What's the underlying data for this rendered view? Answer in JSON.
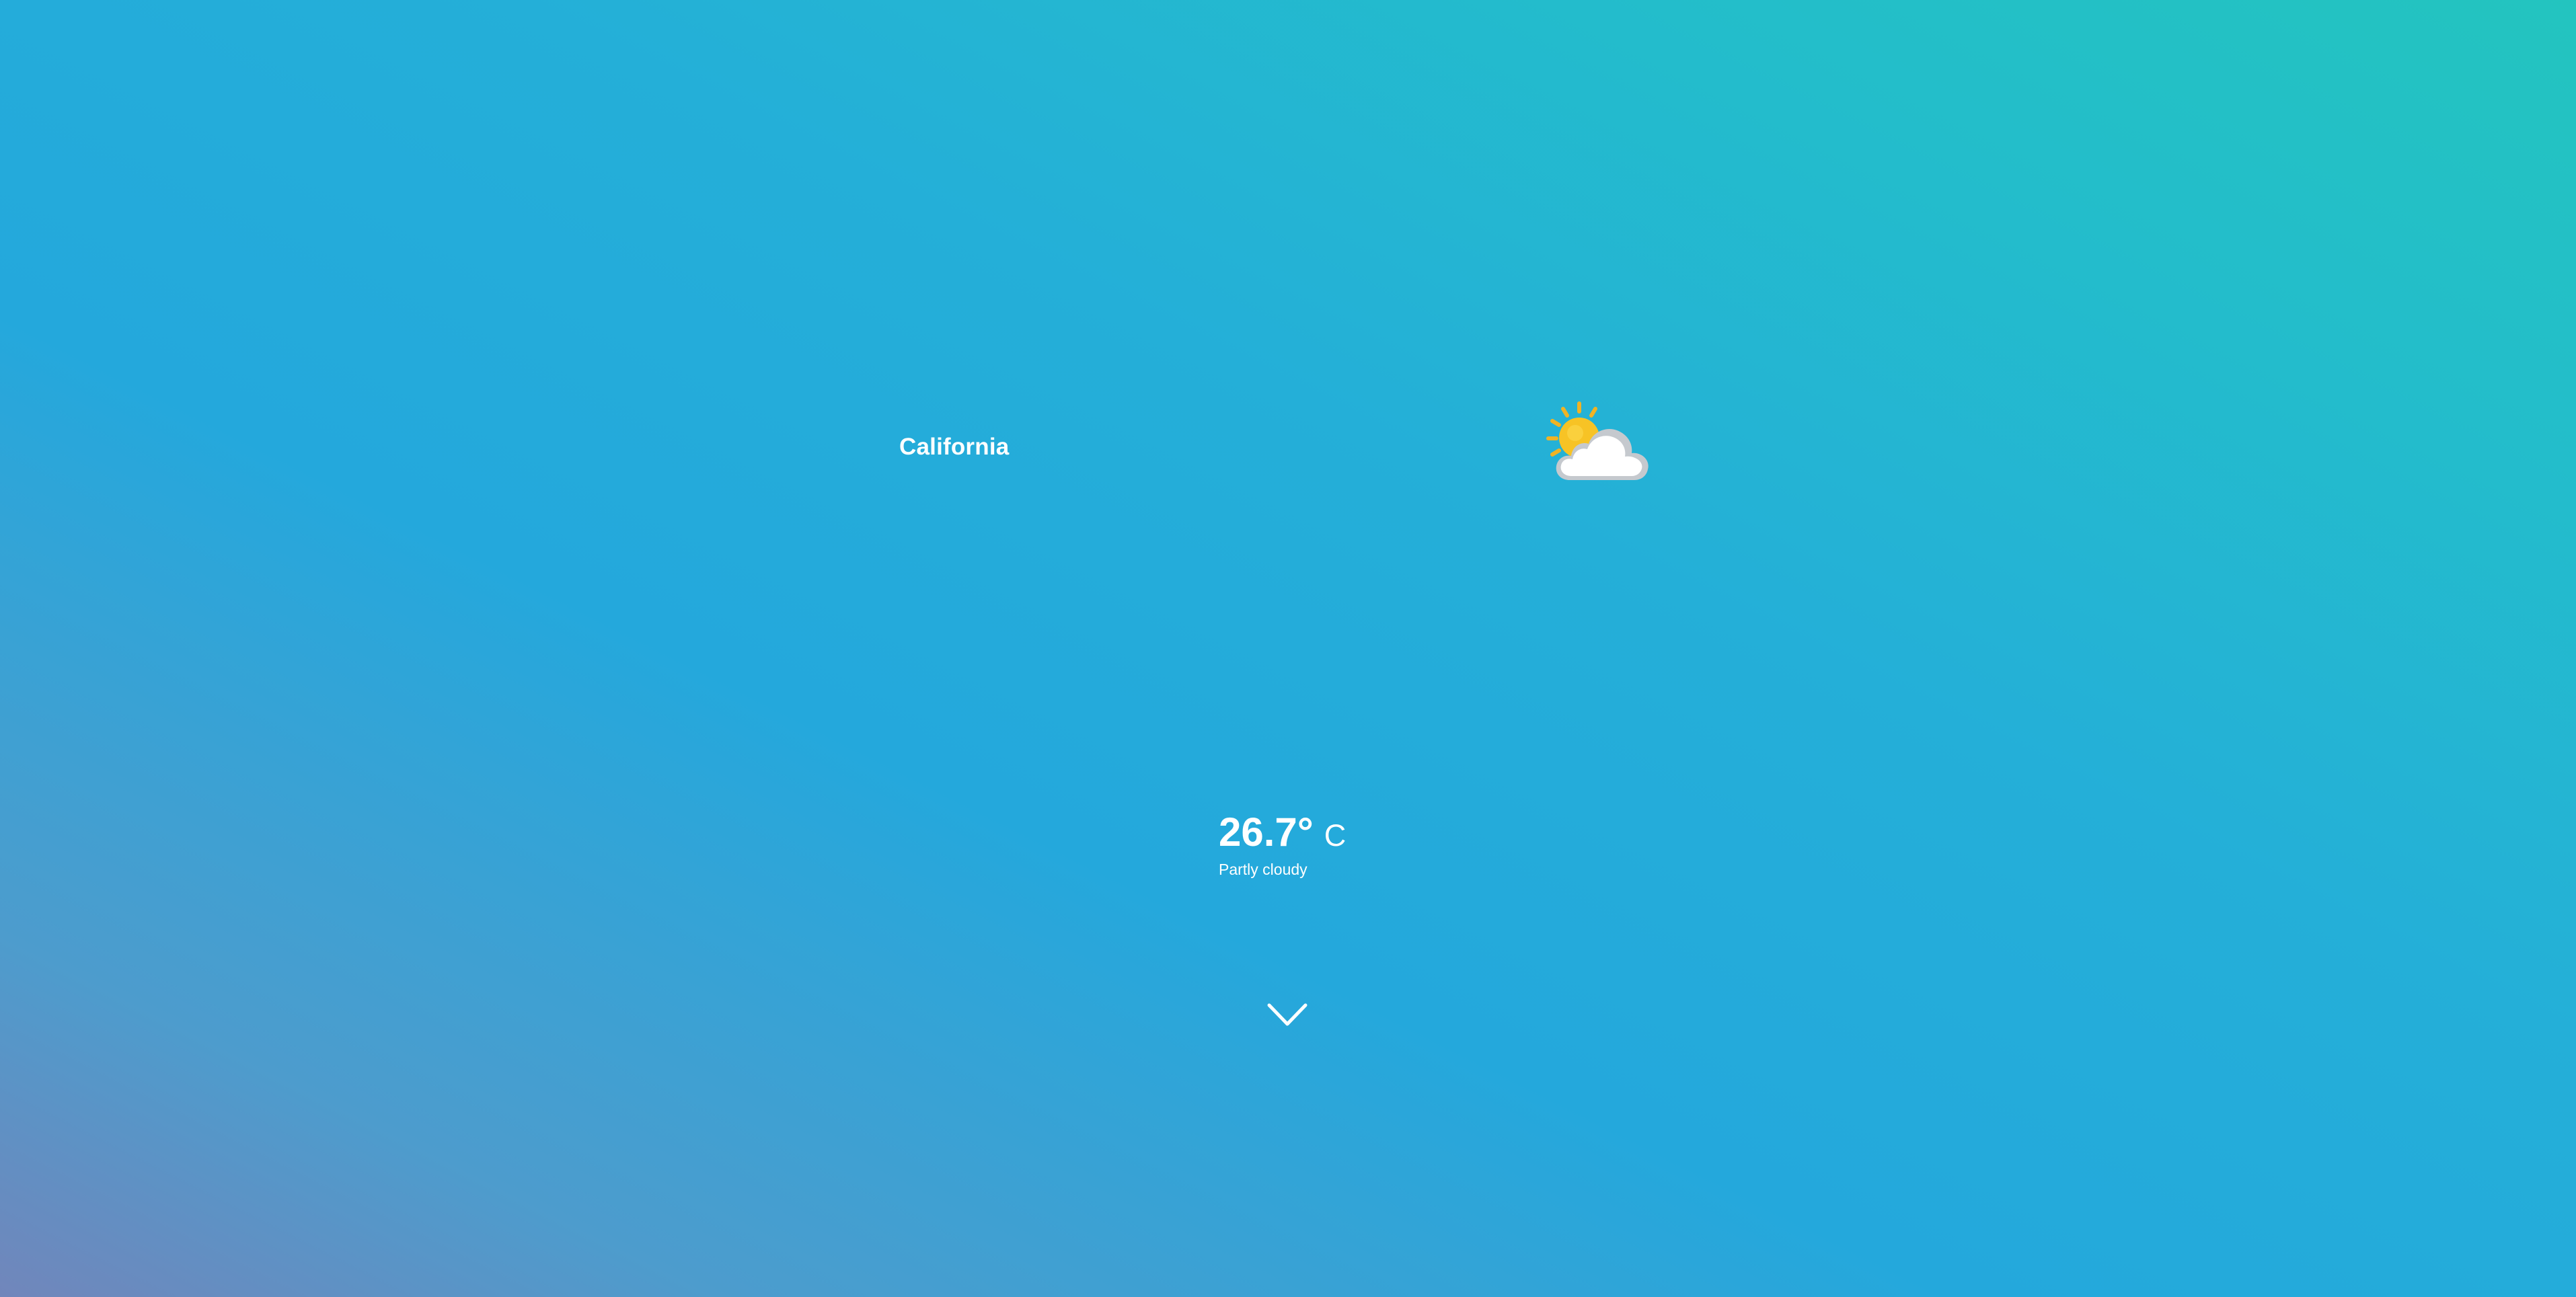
{
  "location": {
    "name": "California"
  },
  "current": {
    "temperature": "26.7°",
    "unit": "C",
    "condition": "Partly cloudy",
    "icon": "partly-cloudy-icon"
  },
  "navigation": {
    "scroll_icon": "chevron-down-icon"
  },
  "colors": {
    "gradient_bottom_left": "#7186bb",
    "gradient_middle": "#24a8dc",
    "gradient_top_right": "#23c4bf",
    "text": "#ffffff",
    "sun": "#f7c325",
    "sun_rays": "#f0b324",
    "cloud": "#ffffff",
    "cloud_outline": "#c5c9ce"
  }
}
